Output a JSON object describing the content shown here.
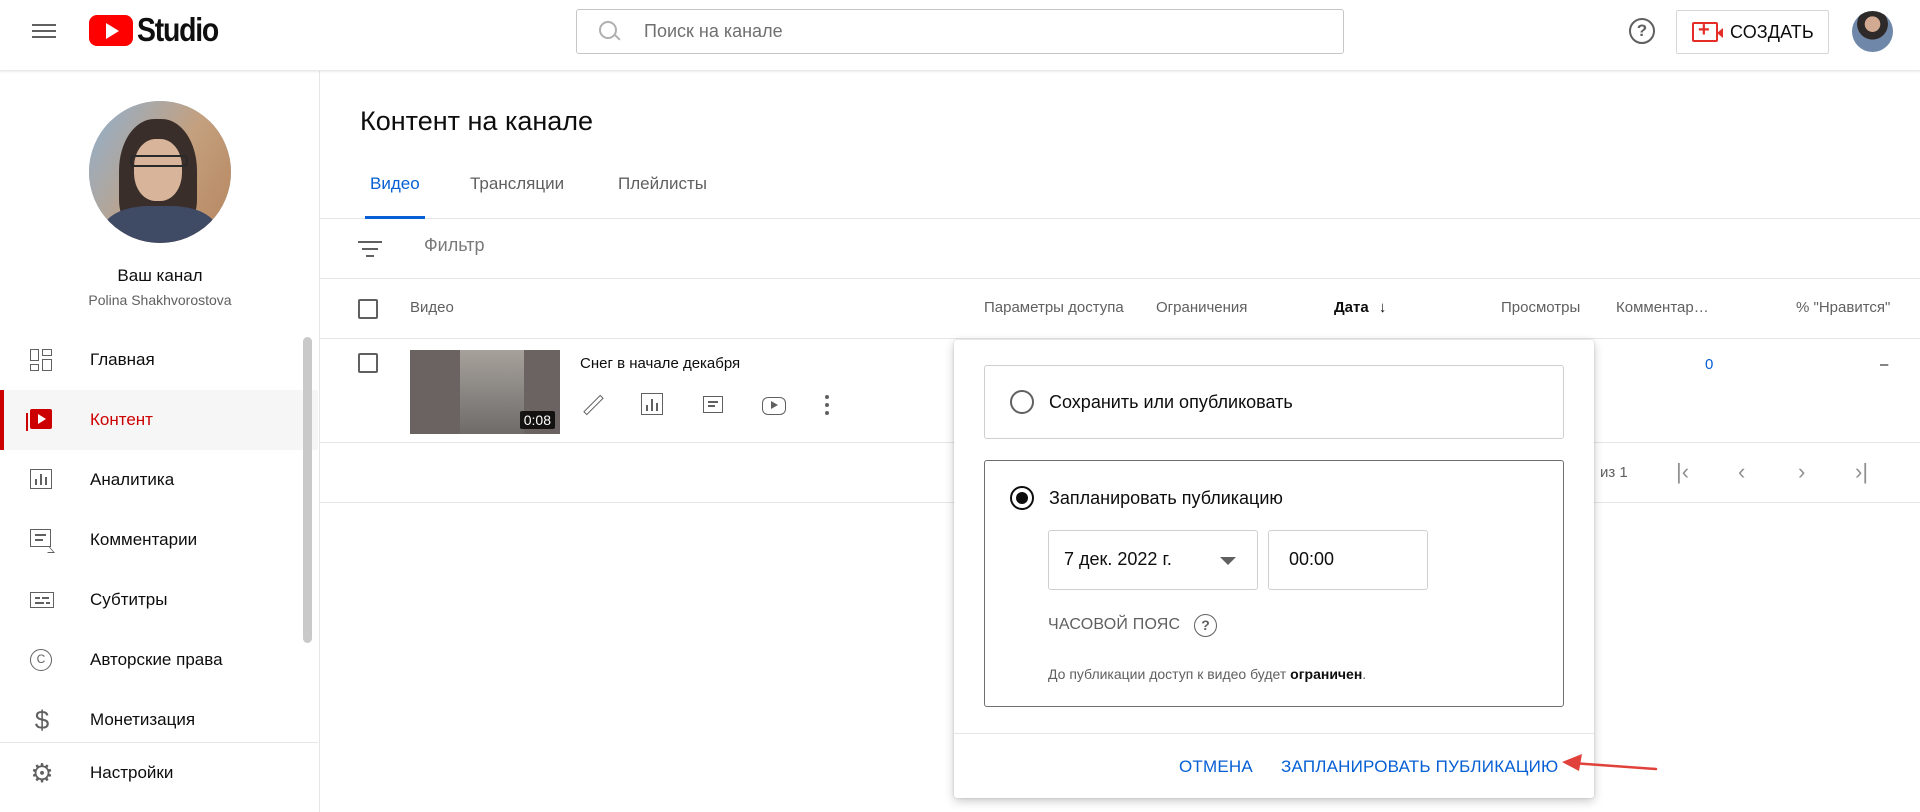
{
  "header": {
    "logo_text": "Studio",
    "search_placeholder": "Поиск на канале",
    "help_label": "?",
    "create_label": "СОЗДАТЬ"
  },
  "sidebar": {
    "channel_title": "Ваш канал",
    "channel_name": "Polina Shakhvorostova",
    "items": [
      {
        "label": "Главная",
        "icon": "dashboard-icon",
        "active": false
      },
      {
        "label": "Контент",
        "icon": "content-icon",
        "active": true
      },
      {
        "label": "Аналитика",
        "icon": "analytics-icon",
        "active": false
      },
      {
        "label": "Комментарии",
        "icon": "comments-icon",
        "active": false
      },
      {
        "label": "Субтитры",
        "icon": "subtitles-icon",
        "active": false
      },
      {
        "label": "Авторские права",
        "icon": "copyright-icon",
        "active": false
      },
      {
        "label": "Монетизация",
        "icon": "monetization-icon",
        "active": false
      }
    ],
    "settings_label": "Настройки"
  },
  "main": {
    "page_title": "Контент на канале",
    "tabs": [
      {
        "label": "Видео",
        "active": true
      },
      {
        "label": "Трансляции",
        "active": false
      },
      {
        "label": "Плейлисты",
        "active": false
      }
    ],
    "filter_placeholder": "Фильтр",
    "columns": {
      "video": "Видео",
      "visibility": "Параметры доступа",
      "restrictions": "Ограничения",
      "date": "Дата",
      "views": "Просмотры",
      "comments": "Комментар…",
      "likes": "% \"Нравится\""
    },
    "row": {
      "title": "Снег в начале декабря",
      "duration": "0:08",
      "comments": "0",
      "likes": "–"
    },
    "pager": {
      "text": "из 1"
    }
  },
  "popup": {
    "option_save": "Сохранить или опубликовать",
    "option_schedule": "Запланировать публикацию",
    "date_value": "7 дек. 2022 г.",
    "time_value": "00:00",
    "timezone_label": "ЧАСОВОЙ ПОЯС",
    "note_prefix": "До публикации доступ к видео будет ",
    "note_bold": "ограничен",
    "note_suffix": ".",
    "cancel_label": "ОТМЕНА",
    "schedule_label": "ЗАПЛАНИРОВАТЬ ПУБЛИКАЦИЮ"
  },
  "colors": {
    "accent": "#065fd4",
    "brand": "#ff0000",
    "active_nav": "#cc0000",
    "arrow": "#e0413a"
  }
}
